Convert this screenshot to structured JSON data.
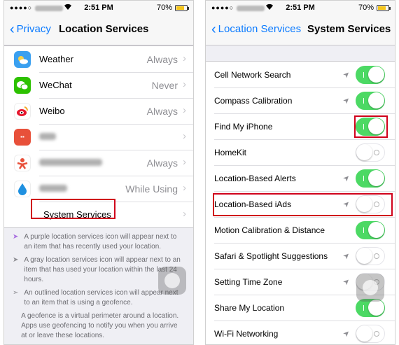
{
  "left": {
    "status": {
      "time": "2:51 PM",
      "battery": "70%"
    },
    "nav": {
      "back": "Privacy",
      "title": "Location Services"
    },
    "apps": [
      {
        "label": "Weather",
        "value": "Always",
        "icon": "weather-icon",
        "color": "#3aa0f0"
      },
      {
        "label": "WeChat",
        "value": "Never",
        "icon": "wechat-icon",
        "color": "#2dc100"
      },
      {
        "label": "Weibo",
        "value": "Always",
        "icon": "weibo-icon",
        "color": "#ffffff"
      },
      {
        "label": "",
        "value": "",
        "icon": "app-icon",
        "color": "#e8503a"
      },
      {
        "label": "",
        "value": "Always",
        "icon": "app-icon",
        "color": "#ffffff"
      },
      {
        "label": "",
        "value": "While Using",
        "icon": "app-icon",
        "color": "#1e90e0"
      }
    ],
    "system_services": "System Services",
    "footer": [
      "A purple location services icon will appear next to an item that has recently used your location.",
      "A gray location services icon will appear next to an item that has used your location within the last 24 hours.",
      "An outlined location services icon will appear next to an item that is using a geofence.",
      "A geofence is a virtual perimeter around a location. Apps use geofencing to notify you when you arrive at or leave these locations."
    ]
  },
  "right": {
    "status": {
      "time": "2:51 PM",
      "battery": "70%"
    },
    "nav": {
      "back": "Location Services",
      "title": "System Services"
    },
    "rows": [
      {
        "label": "Cell Network Search",
        "arrow": true,
        "on": true
      },
      {
        "label": "Compass Calibration",
        "arrow": true,
        "on": true
      },
      {
        "label": "Find My iPhone",
        "arrow": false,
        "on": true
      },
      {
        "label": "HomeKit",
        "arrow": false,
        "on": false
      },
      {
        "label": "Location-Based Alerts",
        "arrow": true,
        "on": true
      },
      {
        "label": "Location-Based iAds",
        "arrow": true,
        "on": false
      },
      {
        "label": "Motion Calibration & Distance",
        "arrow": false,
        "on": true
      },
      {
        "label": "Safari & Spotlight Suggestions",
        "arrow": true,
        "on": false
      },
      {
        "label": "Setting Time Zone",
        "arrow": true,
        "on": false
      },
      {
        "label": "Share My Location",
        "arrow": false,
        "on": true
      },
      {
        "label": "Wi-Fi Networking",
        "arrow": true,
        "on": false
      }
    ]
  },
  "colors": {
    "accent": "#0a7aff",
    "switch_on": "#4cd964",
    "highlight": "#d0021b"
  }
}
